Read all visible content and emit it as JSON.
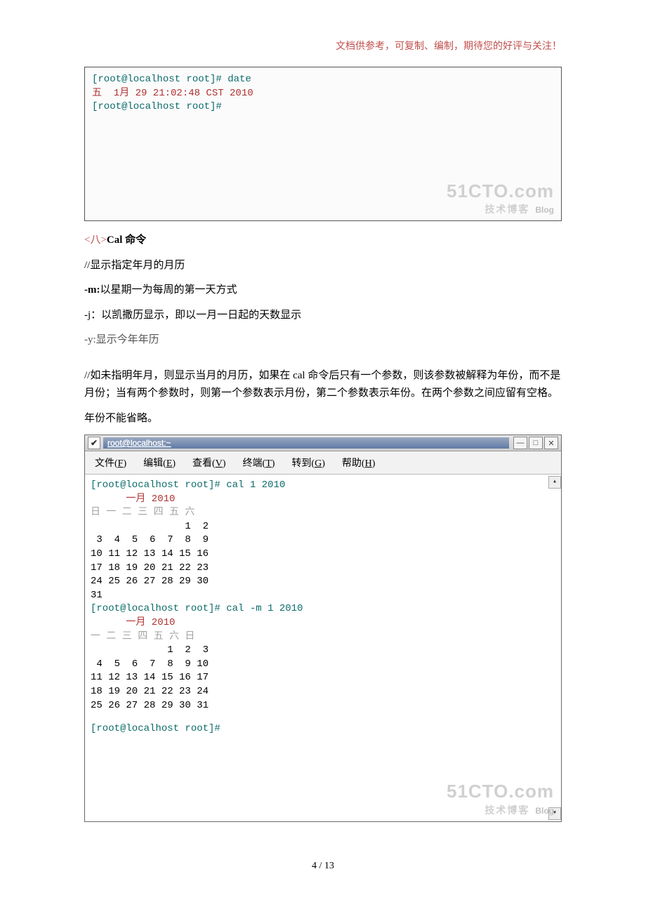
{
  "header_note": "文档供参考，可复制、编制，期待您的好评与关注！",
  "terminal1": {
    "line1": "[root@localhost root]# date",
    "line2": "五  1月 29 21:02:48 CST 2010",
    "line3": "[root@localhost root]#",
    "wm_big": "51CTO.com",
    "wm_small": "技术博客",
    "wm_blog": "Blog"
  },
  "section": {
    "heading_prefix": "<八>",
    "heading_cmd": "Cal 命令",
    "l1": "//显示指定年月的月历",
    "l2a": "-m:",
    "l2b": "以星期一为每周的第一天方式",
    "l3": "-j：以凯撒历显示，即以一月一日起的天数显示",
    "l4": "-y:显示今年年历",
    "p1": "//如未指明年月，则显示当月的月历，如果在 cal 命令后只有一个参数，则该参数被解释为年份，而不是月份；当有两个参数时，则第一个参数表示月份，第二个参数表示年份。在两个参数之间应留有空格。",
    "p2": "年份不能省略。"
  },
  "win": {
    "title": "root@localhost:~",
    "btn_min": "—",
    "btn_max": "□",
    "btn_close": "✕",
    "menu": {
      "file": {
        "label": "文件",
        "u": "F"
      },
      "edit": {
        "label": "编辑",
        "u": "E"
      },
      "view": {
        "label": "查看",
        "u": "V"
      },
      "term": {
        "label": "终端",
        "u": "T"
      },
      "goto": {
        "label": "转到",
        "u": "G"
      },
      "help": {
        "label": "帮助",
        "u": "H"
      }
    },
    "body": {
      "cmd1": "[root@localhost root]# cal 1 2010",
      "month1": "      一月 2010",
      "hdr1": "日 一 二 三 四 五 六",
      "r1a": "                1  2",
      "r1b": " 3  4  5  6  7  8  9",
      "r1c": "10 11 12 13 14 15 16",
      "r1d": "17 18 19 20 21 22 23",
      "r1e": "24 25 26 27 28 29 30",
      "r1f": "31",
      "cmd2": "[root@localhost root]# cal -m 1 2010",
      "month2": "      一月 2010",
      "hdr2": "一 二 三 四 五 六 日",
      "r2a": "             1  2  3",
      "r2b": " 4  5  6  7  8  9 10",
      "r2c": "11 12 13 14 15 16 17",
      "r2d": "18 19 20 21 22 23 24",
      "r2e": "25 26 27 28 29 30 31",
      "cmd3": "[root@localhost root]#",
      "wm_big": "51CTO.com",
      "wm_small": "技术博客",
      "wm_blog": "Blog"
    },
    "scroll_up": "▴",
    "scroll_down": "▾"
  },
  "page_num": "4 / 13"
}
